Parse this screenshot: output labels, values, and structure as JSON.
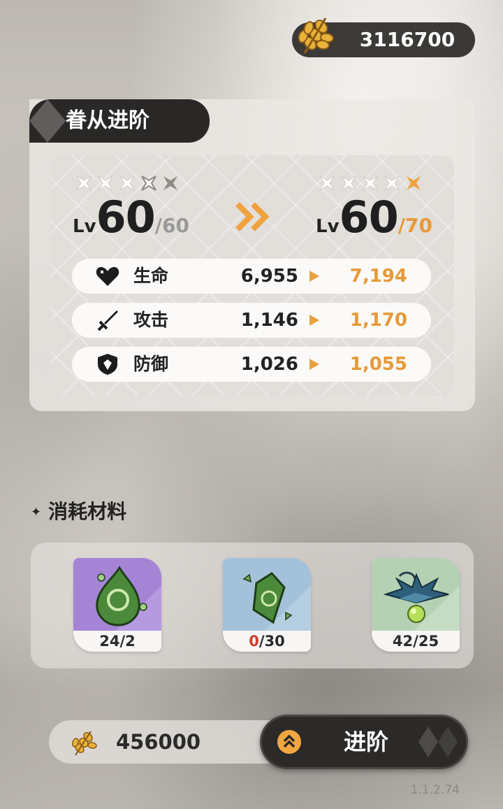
{
  "currency": {
    "top_amount": "3116700"
  },
  "panel": {
    "title": "眷从进阶"
  },
  "level": {
    "prefix": "Lv",
    "current": {
      "level": "60",
      "max": "/60",
      "stars_filled": 3,
      "stars_total": 5
    },
    "next": {
      "level": "60",
      "max": "/70",
      "stars_filled": 4,
      "stars_total": 5
    }
  },
  "stats": [
    {
      "icon": "heart-icon",
      "label": "生命",
      "old": "6,955",
      "new": "7,194"
    },
    {
      "icon": "sword-icon",
      "label": "攻击",
      "old": "1,146",
      "new": "1,170"
    },
    {
      "icon": "shield-icon",
      "label": "防御",
      "old": "1,026",
      "new": "1,055"
    }
  ],
  "materials": {
    "heading": "消耗材料",
    "items": [
      {
        "icon": "green-gem-drop-icon",
        "count_have": "24",
        "count_need": "/2",
        "rarity_color": "#a98ad6"
      },
      {
        "icon": "green-gem-shard-icon",
        "count_have": "0",
        "count_need": "/30",
        "rarity_color": "#a9c6dd"
      },
      {
        "icon": "blue-flower-bulb-icon",
        "count_have": "42",
        "count_need": "/25",
        "rarity_color": "#b7d2b6"
      }
    ]
  },
  "footer": {
    "cost_amount": "456000",
    "advance_label": "进阶",
    "version": "1.1.2.74"
  },
  "colors": {
    "accent": "#e79a3a",
    "dark": "#2a2826",
    "shortage": "#d23c2c"
  }
}
